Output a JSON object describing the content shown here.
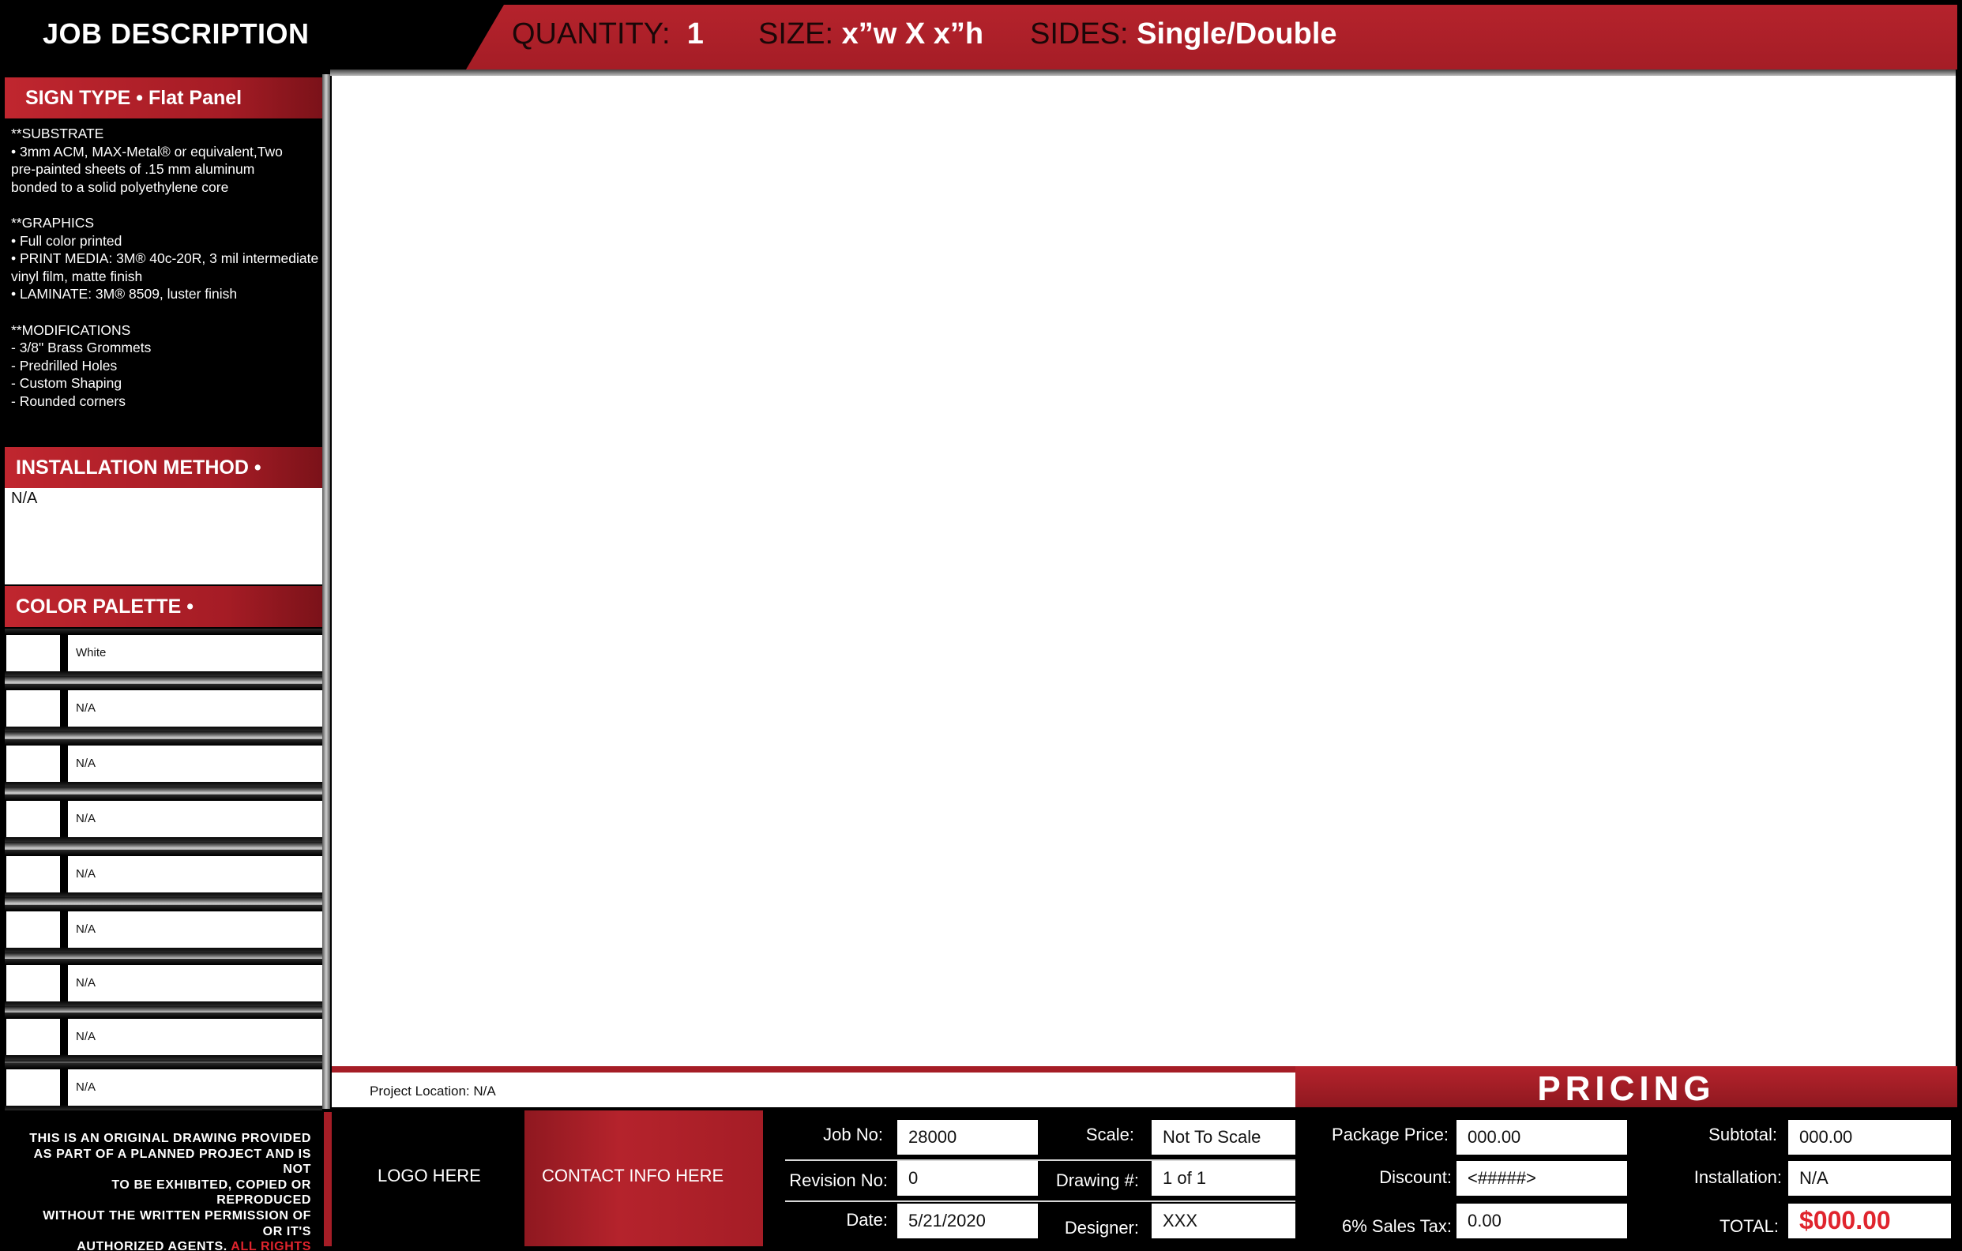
{
  "header": {
    "title": "JOB DESCRIPTION",
    "quantity_label": "QUANTITY:",
    "quantity_value": "1",
    "size_label": "SIZE:",
    "size_value": "x”w X x”h",
    "sides_label": "SIDES:",
    "sides_value": "Single/Double"
  },
  "sign_type": {
    "heading": "SIGN TYPE • Flat Panel",
    "lines": [
      "**SUBSTRATE",
      "• 3mm ACM, MAX-Metal® or equivalent,Two",
      "pre-painted sheets of .15 mm aluminum",
      "bonded to a solid polyethylene core",
      "",
      "**GRAPHICS",
      "• Full color printed",
      "• PRINT MEDIA: 3M® 40c-20R, 3 mil intermediate",
      "vinyl film, matte finish",
      "• LAMINATE: 3M® 8509, luster finish",
      "",
      "**MODIFICATIONS",
      "- 3/8\" Brass Grommets",
      "- Predrilled Holes",
      "- Custom Shaping",
      "- Rounded corners"
    ]
  },
  "installation": {
    "heading": "INSTALLATION METHOD •",
    "value": "N/A"
  },
  "color_palette": {
    "heading": "COLOR PALETTE •",
    "colors": [
      "White",
      "N/A",
      "N/A",
      "N/A",
      "N/A",
      "N/A",
      "N/A",
      "N/A",
      "N/A"
    ]
  },
  "project_location": "Project Location: N/A",
  "pricing_heading": "PRICING",
  "footer": {
    "legal_lines": [
      "THIS IS AN ORIGINAL DRAWING PROVIDED",
      "AS PART OF A PLANNED PROJECT AND IS NOT",
      "TO BE EXHIBITED, COPIED OR REPRODUCED",
      "WITHOUT THE WRITTEN PERMISSION OF",
      "OR IT'S"
    ],
    "legal_last_white": "AUTHORIZED AGENTS.",
    "legal_last_red": "ALL RIGHTS RESERVED.",
    "logo": "LOGO HERE",
    "contact": "CONTACT INFO HERE",
    "job_no_label": "Job No:",
    "job_no": "28000",
    "revision_label": "Revision No:",
    "revision": "0",
    "date_label": "Date:",
    "date": "5/21/2020",
    "scale_label": "Scale:",
    "scale": "Not To Scale",
    "drawing_label": "Drawing #:",
    "drawing": "1 of 1",
    "designer_label": "Designer:",
    "designer": "XXX",
    "package_price_label": "Package Price:",
    "package_price": "000.00",
    "discount_label": "Discount:",
    "discount": "<#####>",
    "sales_tax_label": "6% Sales Tax:",
    "sales_tax": "0.00",
    "subtotal_label": "Subtotal:",
    "subtotal": "000.00",
    "installation_label": "Installation:",
    "installation": "N/A",
    "total_label": "TOTAL:",
    "total": "$000.00"
  },
  "colors": {
    "brand_red": "#a51d26",
    "accent_red": "#e0242d",
    "black": "#000000",
    "white": "#ffffff"
  }
}
